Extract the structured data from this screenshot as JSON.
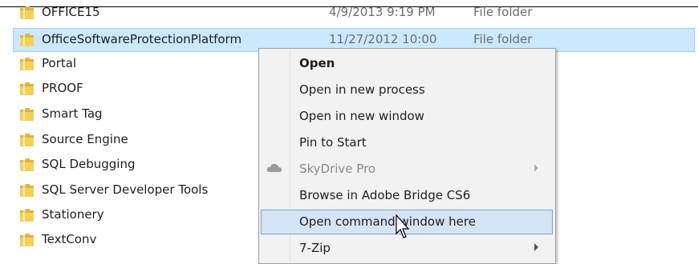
{
  "files": [
    {
      "name": "OFFICE15",
      "date": "4/9/2013 9:19 PM",
      "type": "File folder",
      "selected": false
    },
    {
      "name": "OfficeSoftwareProtectionPlatform",
      "date": "11/27/2012 10:00",
      "type": "File folder",
      "selected": true
    },
    {
      "name": "Portal",
      "date": "",
      "type": "",
      "selected": false
    },
    {
      "name": "PROOF",
      "date": "",
      "type": "",
      "selected": false
    },
    {
      "name": "Smart Tag",
      "date": "",
      "type": "",
      "selected": false
    },
    {
      "name": "Source Engine",
      "date": "",
      "type": "",
      "selected": false
    },
    {
      "name": "SQL Debugging",
      "date": "",
      "type": "",
      "selected": false
    },
    {
      "name": "SQL Server Developer Tools",
      "date": "",
      "type": "",
      "selected": false
    },
    {
      "name": "Stationery",
      "date": "",
      "type": "",
      "selected": false
    },
    {
      "name": "TextConv",
      "date": "",
      "type": "",
      "selected": false
    }
  ],
  "context_menu": {
    "items": [
      {
        "label": "Open",
        "bold": true,
        "disabled": false,
        "submenu": false,
        "hover": false,
        "icon": null
      },
      {
        "label": "Open in new process",
        "bold": false,
        "disabled": false,
        "submenu": false,
        "hover": false,
        "icon": null
      },
      {
        "label": "Open in new window",
        "bold": false,
        "disabled": false,
        "submenu": false,
        "hover": false,
        "icon": null
      },
      {
        "label": "Pin to Start",
        "bold": false,
        "disabled": false,
        "submenu": false,
        "hover": false,
        "icon": null
      },
      {
        "label": "SkyDrive Pro",
        "bold": false,
        "disabled": true,
        "submenu": true,
        "hover": false,
        "icon": "skydrive-cloud-icon"
      },
      {
        "label": "Browse in Adobe Bridge CS6",
        "bold": false,
        "disabled": false,
        "submenu": false,
        "hover": false,
        "icon": null
      },
      {
        "label": "Open command window here",
        "bold": false,
        "disabled": false,
        "submenu": false,
        "hover": true,
        "icon": null
      },
      {
        "label": "7-Zip",
        "bold": false,
        "disabled": false,
        "submenu": true,
        "hover": false,
        "icon": null
      }
    ]
  },
  "colors": {
    "selection_bg": "#cce8ff",
    "menu_hover_bg": "#d5e4f5",
    "folder_yellow": "#f5cf5a"
  }
}
